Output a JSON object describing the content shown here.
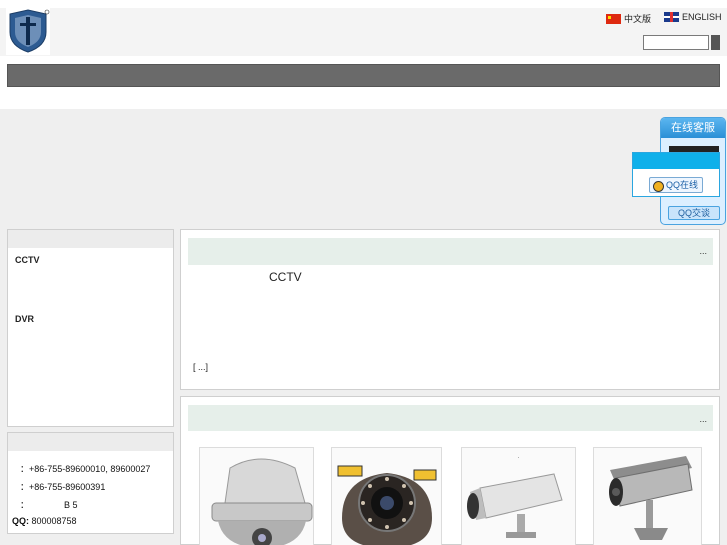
{
  "header": {
    "lang_cn": "中文版",
    "lang_en": "ENGLISH",
    "search": {
      "value": "",
      "placeholder": ""
    }
  },
  "sidebar": {
    "categories": [
      {
        "label": "CCTV"
      },
      {
        "label": "DVR"
      }
    ],
    "contact": {
      "phone": "：+86-755-89600010, 89600027",
      "fax": "：+86-755-89600391",
      "address": "：              B 5",
      "qq_label": "QQ:",
      "qq_value": "800008758"
    }
  },
  "intro": {
    "more": "...",
    "text": "CCTV",
    "detail": "[ ...]"
  },
  "products": {
    "more": "...",
    "items": [
      {
        "name": "speed-dome-camera",
        "caption": ""
      },
      {
        "name": "focus-zoom-dome-camera",
        "caption": ""
      },
      {
        "name": "bullet-camera",
        "caption": "."
      },
      {
        "name": "outdoor-bullet-camera",
        "caption": ""
      }
    ]
  },
  "qq_service": {
    "title": "在线客服",
    "online": "QQ在线",
    "chat_button": "QQ交谈"
  },
  "colors": {
    "nav_bar": "#6a6a6a",
    "section_header": "#e6efea",
    "qq_accent": "#2a8fd6",
    "qq_popup_head": "#0fb0ea"
  }
}
